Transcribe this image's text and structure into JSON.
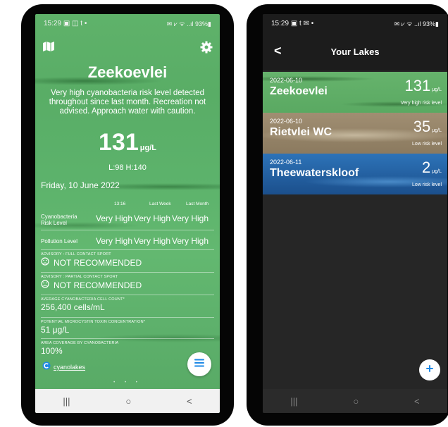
{
  "left": {
    "status": {
      "time": "15:29",
      "icons": "▣ ◫ t •",
      "right": "✉ ⩗ ᯤ ..ıl 93%▮"
    },
    "lake_name": "Zeekoevlei",
    "advisory": "Very high cyanobacteria risk level detected throughout since last month. Recreation not advised. Approach water with caution.",
    "value": "131",
    "unit": "μg/L",
    "low_high": "L:98  H:140",
    "date": "Friday, 10 June 2022",
    "col_headers": [
      "13:16",
      "Last Week",
      "Last Month"
    ],
    "rows": [
      {
        "label": "Cyanobacteria Risk Level",
        "values": [
          "Very High",
          "Very High",
          "Very High"
        ]
      },
      {
        "label": "Pollution Level",
        "values": [
          "Very High",
          "Very High",
          "Very High"
        ]
      }
    ],
    "info": [
      {
        "label": "ADVISORY : FULL CONTACT SPORT",
        "value": "NOT RECOMMENDED"
      },
      {
        "label": "ADVISORY : PARTIAL CONTACT SPORT",
        "value": "NOT RECOMMENDED"
      },
      {
        "label": "AVERAGE CYANOBACTERIA CELL COUNT*",
        "value": "256,400 cells/mL"
      },
      {
        "label": "POTENTIAL MICROCYSTIN TOXIN CONCENTRATION*",
        "value": "51 μg/L"
      },
      {
        "label": "AREA COVERAGE BY CYANOBACTERIA",
        "value": "100%"
      }
    ],
    "brand": "cyanolakes",
    "page_dots": "• • •",
    "nav": [
      "|||",
      "○",
      "<"
    ]
  },
  "right": {
    "status": {
      "time": "15:29",
      "icons": "▣ t ✉ •",
      "right": "✉ ⩗ ᯤ ..ıl 93%▮"
    },
    "title": "Your Lakes",
    "back": "<",
    "lakes": [
      {
        "date": "2022-06-10",
        "name": "Zeekoevlei",
        "value": "131",
        "unit": "μg/L",
        "risk": "Very high risk level",
        "style": "green"
      },
      {
        "date": "2022-06-10",
        "name": "Rietvlei WC",
        "value": "35",
        "unit": "μg/L",
        "risk": "Low risk level",
        "style": "tan"
      },
      {
        "date": "2022-06-11",
        "name": "Theewaterskloof",
        "value": "2",
        "unit": "μg/L",
        "risk": "Low risk level",
        "style": "blue"
      }
    ],
    "nav": [
      "|||",
      "○",
      "<"
    ]
  },
  "colors": {
    "accent": "#1e88e5",
    "water_green": "#5db06b",
    "dark_bg": "#262626"
  },
  "icons": {
    "map": "map-icon",
    "settings": "gear-icon",
    "menu": "menu-icon",
    "add": "plus-icon",
    "sad": "sad-face-icon"
  }
}
